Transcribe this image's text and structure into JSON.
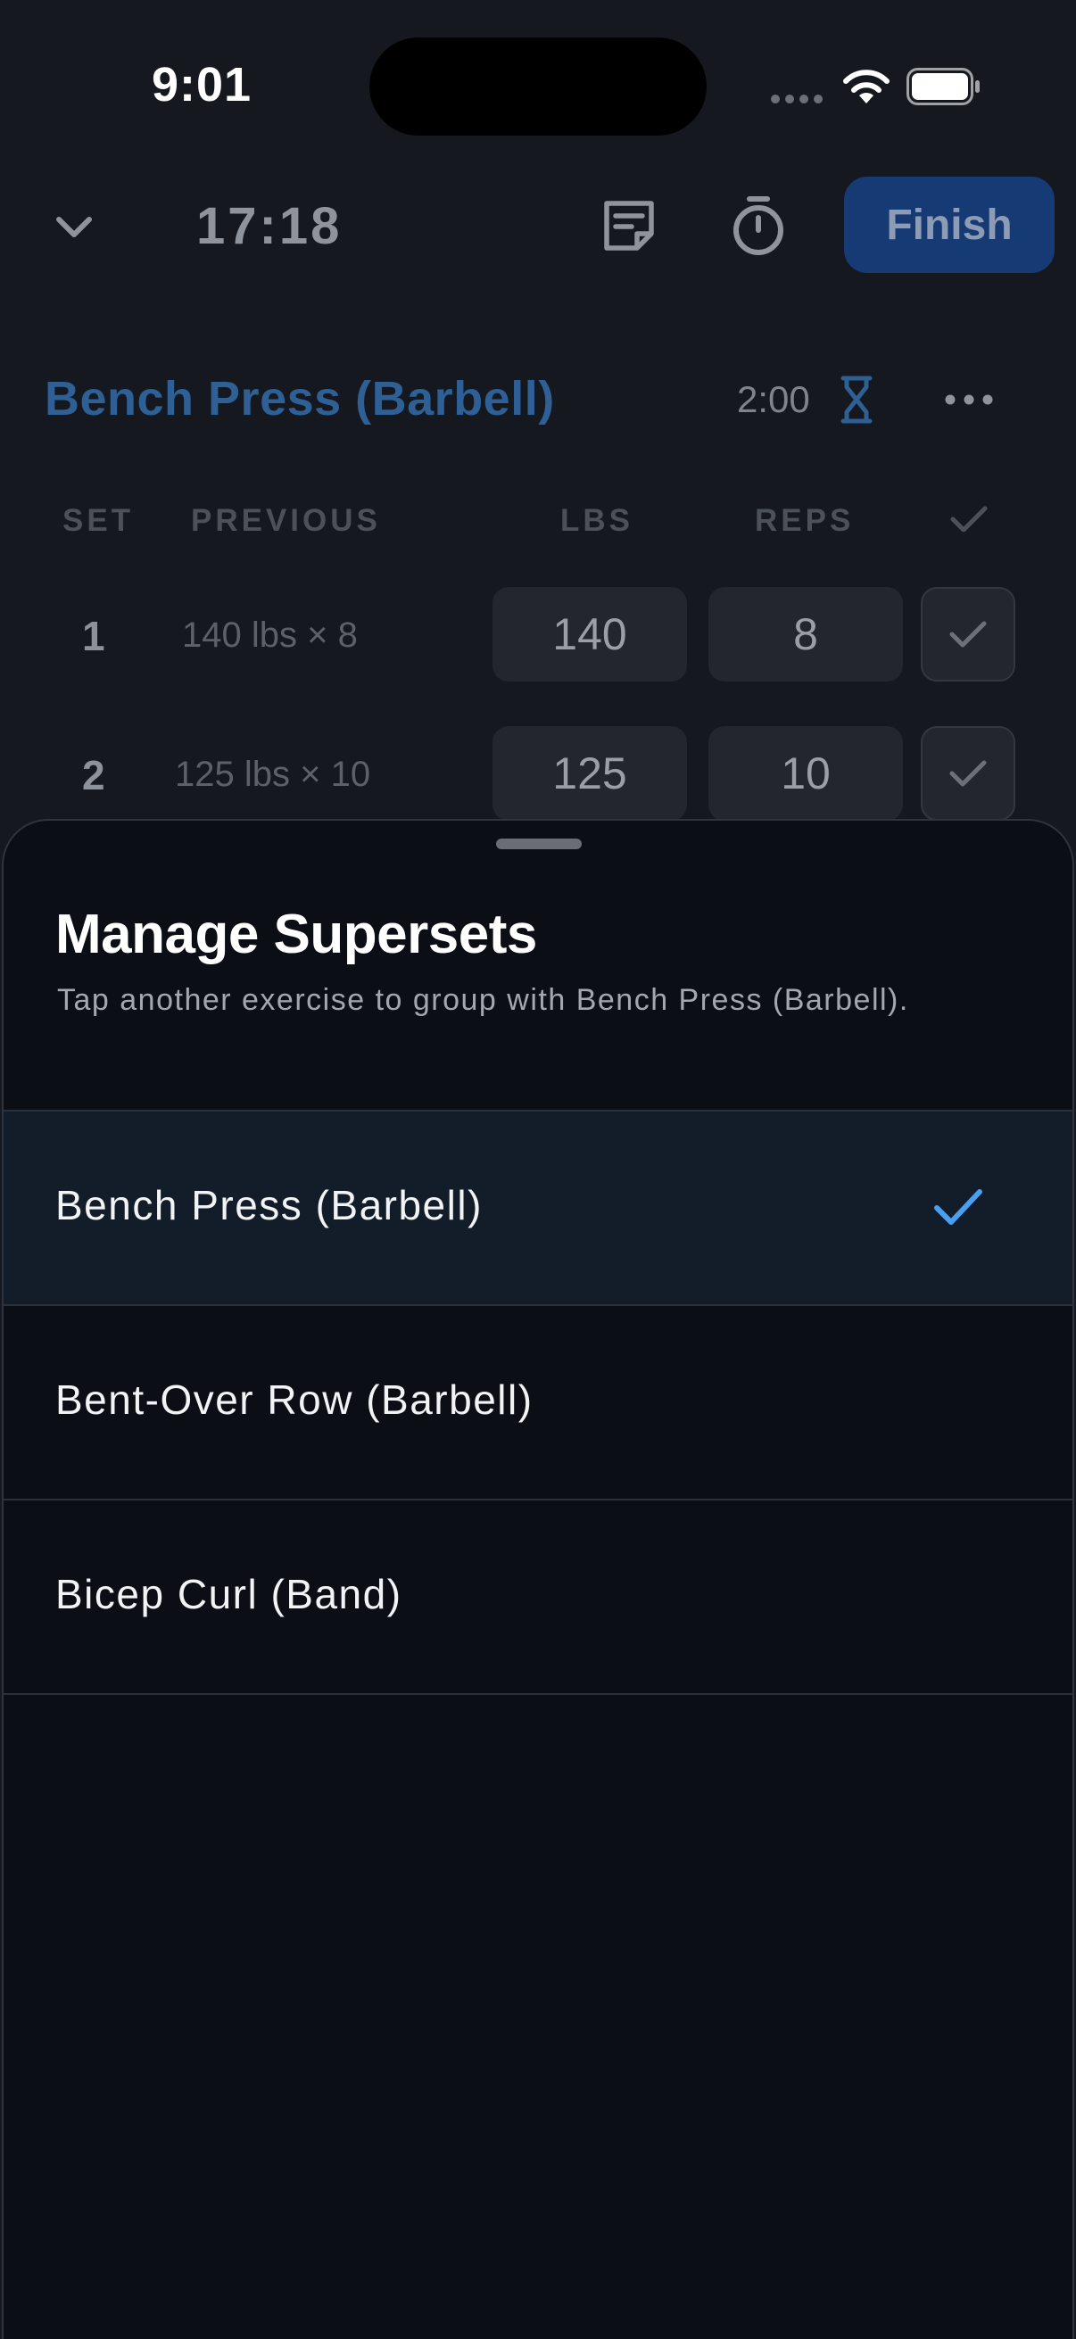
{
  "status_bar": {
    "time": "9:01"
  },
  "workout": {
    "elapsed": "17:18",
    "finish_label": "Finish",
    "exercise_title": "Bench Press (Barbell)",
    "rest_time": "2:00",
    "columns": {
      "set": "SET",
      "previous": "PREVIOUS",
      "lbs": "LBS",
      "reps": "REPS"
    },
    "sets": [
      {
        "number": "1",
        "previous": "140 lbs × 8",
        "lbs": "140",
        "reps": "8"
      },
      {
        "number": "2",
        "previous": "125 lbs × 10",
        "lbs": "125",
        "reps": "10"
      }
    ]
  },
  "sheet": {
    "title": "Manage Supersets",
    "subtitle": "Tap another exercise to group with Bench Press (Barbell).",
    "items": [
      {
        "label": "Bench Press (Barbell)",
        "selected": true
      },
      {
        "label": "Bent-Over Row (Barbell)",
        "selected": false
      },
      {
        "label": "Bicep Curl (Band)",
        "selected": false
      }
    ]
  },
  "colors": {
    "accent": "#4a9ff0",
    "finish_button": "#163a73",
    "sheet_background": "#0b0e15",
    "selected_row": "#131d2a"
  },
  "icons": {
    "collapse": "chevron-down-icon",
    "notes": "notes-icon",
    "timer": "stopwatch-icon",
    "rest": "hourglass-icon",
    "menu": "more-icon",
    "selected": "check-icon"
  }
}
